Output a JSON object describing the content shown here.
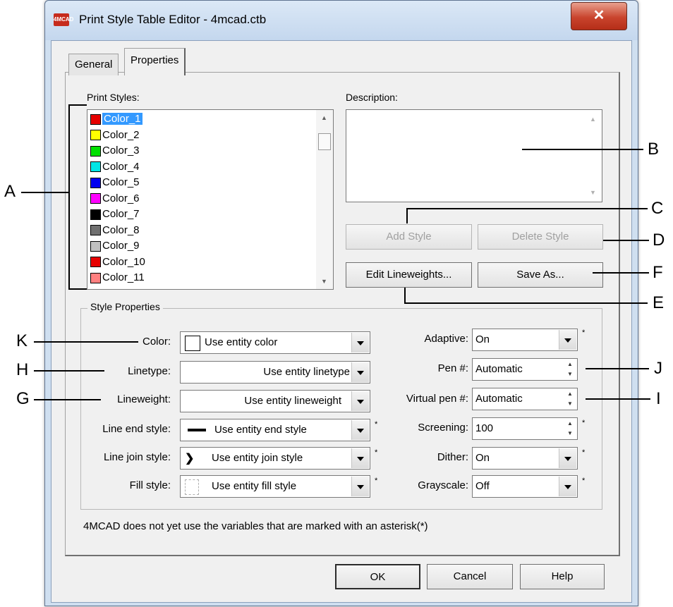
{
  "window": {
    "title": "Print Style Table Editor - 4mcad.ctb",
    "app_icon": "4MCAD",
    "close": "✕"
  },
  "tabs": [
    "General",
    "Properties"
  ],
  "print_styles": {
    "label": "Print Styles:",
    "items": [
      {
        "name": "Color_1",
        "color": "#e60000"
      },
      {
        "name": "Color_2",
        "color": "#ffff00"
      },
      {
        "name": "Color_3",
        "color": "#00e000"
      },
      {
        "name": "Color_4",
        "color": "#00e6e6"
      },
      {
        "name": "Color_5",
        "color": "#0000f0"
      },
      {
        "name": "Color_6",
        "color": "#ff00ff"
      },
      {
        "name": "Color_7",
        "color": "#000000"
      },
      {
        "name": "Color_8",
        "color": "#707070"
      },
      {
        "name": "Color_9",
        "color": "#c0c0c0"
      },
      {
        "name": "Color_10",
        "color": "#e60000"
      },
      {
        "name": "Color_11",
        "color": "#ff8080"
      }
    ]
  },
  "description": {
    "label": "Description:"
  },
  "buttons": {
    "add_style": "Add Style",
    "delete_style": "Delete Style",
    "edit_lineweights": "Edit Lineweights...",
    "save_as": "Save As...",
    "ok": "OK",
    "cancel": "Cancel",
    "help": "Help"
  },
  "style_properties": {
    "label": "Style Properties",
    "color": {
      "label": "Color:",
      "value": "Use entity color"
    },
    "linetype": {
      "label": "Linetype:",
      "value": "Use entity linetype"
    },
    "lineweight": {
      "label": "Lineweight:",
      "value": "Use entity lineweight"
    },
    "line_end": {
      "label": "Line end style:",
      "value": "Use entity end style"
    },
    "line_join": {
      "label": "Line join style:",
      "value": "Use entity join style"
    },
    "fill": {
      "label": "Fill style:",
      "value": "Use entity fill style"
    },
    "adaptive": {
      "label": "Adaptive:",
      "value": "On"
    },
    "pen": {
      "label": "Pen #:",
      "value": "Automatic"
    },
    "virtual_pen": {
      "label": "Virtual pen #:",
      "value": "Automatic"
    },
    "screening": {
      "label": "Screening:",
      "value": "100"
    },
    "dither": {
      "label": "Dither:",
      "value": "On"
    },
    "grayscale": {
      "label": "Grayscale:",
      "value": "Off"
    }
  },
  "footnote": "4MCAD does not yet use the variables that are marked with an asterisk(*)",
  "asterisk": "*",
  "callouts": [
    "A",
    "B",
    "C",
    "D",
    "E",
    "F",
    "G",
    "H",
    "I",
    "J",
    "K"
  ]
}
